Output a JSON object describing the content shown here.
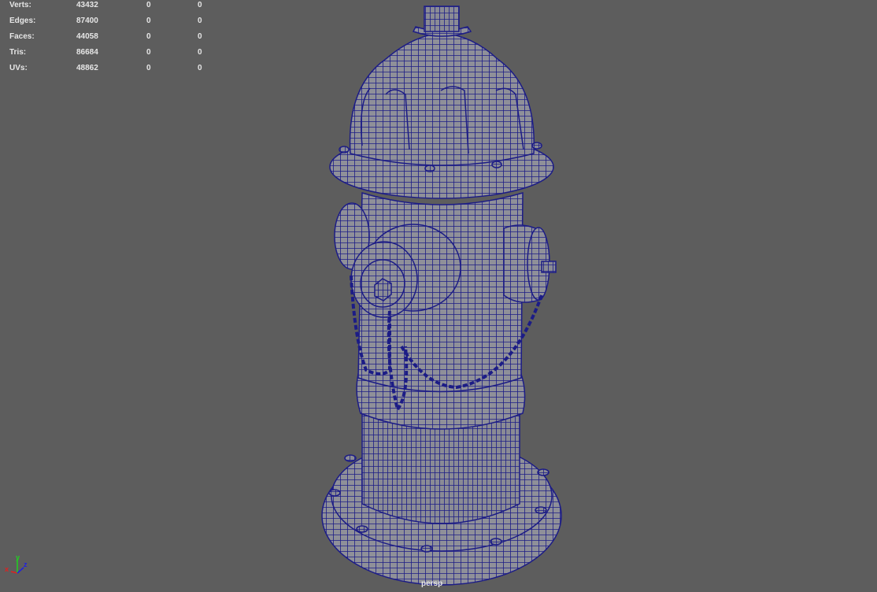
{
  "stats": [
    {
      "label": "Verts:",
      "total": "43432",
      "selected": "0",
      "extra": "0"
    },
    {
      "label": "Edges:",
      "total": "87400",
      "selected": "0",
      "extra": "0"
    },
    {
      "label": "Faces:",
      "total": "44058",
      "selected": "0",
      "extra": "0"
    },
    {
      "label": "Tris:",
      "total": "86684",
      "selected": "0",
      "extra": "0"
    },
    {
      "label": "UVs:",
      "total": "48862",
      "selected": "0",
      "extra": "0"
    }
  ],
  "camera_label": "persp",
  "axis": {
    "x": "x",
    "y": "y",
    "z": "z"
  },
  "colors": {
    "background": "#5d5d5d",
    "wire": "#1c1c86",
    "surface": "#8f9099",
    "x_axis": "#e02020",
    "y_axis": "#20d020",
    "z_axis": "#2020e0"
  }
}
